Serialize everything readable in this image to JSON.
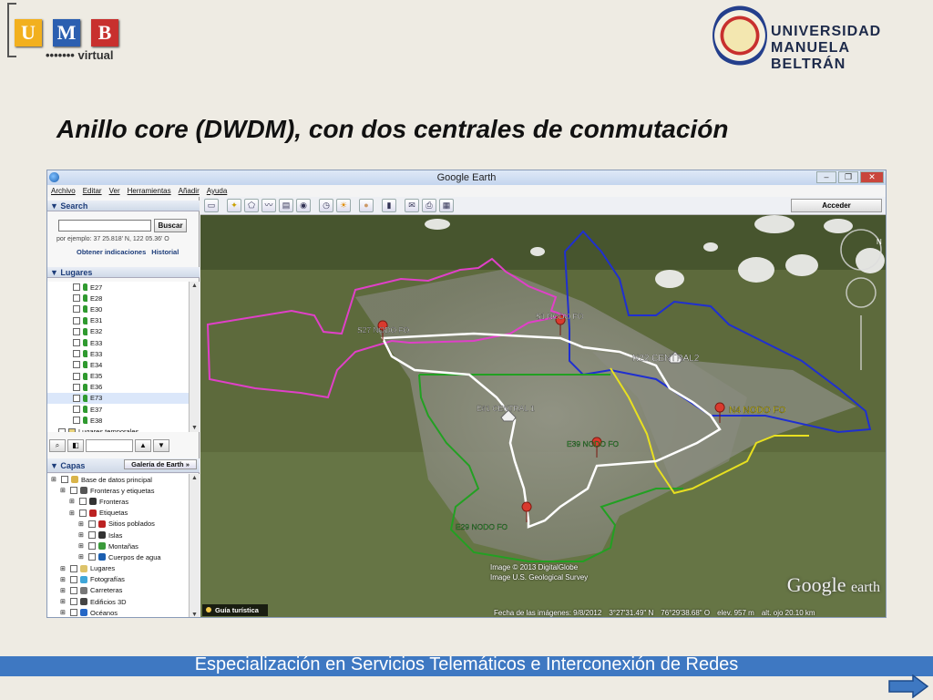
{
  "slide": {
    "title": "Anillo core (DWDM), con dos centrales de conmutación",
    "footer": "Especialización en Servicios Telemáticos e Interconexión de Redes"
  },
  "logos": {
    "umb_letters": [
      "U",
      "M",
      "B"
    ],
    "umb_colors": [
      "#f2b01e",
      "#2b5fb0",
      "#c8302e"
    ],
    "umb_virtual": "virtual",
    "university_line1": "UNIVERSIDAD",
    "university_line2": "MANUELA BELTRÁN"
  },
  "window": {
    "title": "Google Earth",
    "controls": [
      "–",
      "❐",
      "✕"
    ]
  },
  "menu": [
    "Archivo",
    "Editar",
    "Ver",
    "Herramientas",
    "Añadir",
    "Ayuda"
  ],
  "toolbar": {
    "icons": [
      "sidebar-icon",
      "placemark-icon",
      "polygon-icon",
      "path-icon",
      "overlay-icon",
      "tour-icon",
      "historical-imagery-icon",
      "sunlight-icon",
      "planets-icon",
      "ruler-icon",
      "email-icon",
      "print-icon",
      "maps-icon"
    ],
    "acceder_label": "Acceder"
  },
  "search": {
    "header": "▼ Search",
    "button": "Buscar",
    "example": "por ejemplo: 37 25.818' N, 122 05.36' O",
    "link_directions": "Obtener indicaciones",
    "link_history": "Historial"
  },
  "places": {
    "header": "▼ Lugares",
    "items": [
      "E27",
      "E28",
      "E30",
      "E31",
      "E32",
      "E33",
      "E33",
      "E34",
      "E35",
      "E36",
      "E73",
      "E37",
      "E38"
    ],
    "selected": "E73",
    "temporary": "Lugares temporales"
  },
  "layers": {
    "header": "▼ Capas",
    "gallery_button": "Galería de Earth »",
    "items": [
      {
        "label": "Base de datos principal",
        "indent": 0
      },
      {
        "label": "Fronteras y etiquetas",
        "indent": 1
      },
      {
        "label": "Fronteras",
        "indent": 2
      },
      {
        "label": "Etiquetas",
        "indent": 2
      },
      {
        "label": "Sitios poblados",
        "indent": 3
      },
      {
        "label": "Islas",
        "indent": 3
      },
      {
        "label": "Montañas",
        "indent": 3
      },
      {
        "label": "Cuerpos de agua",
        "indent": 3
      },
      {
        "label": "Lugares",
        "indent": 1
      },
      {
        "label": "Fotografías",
        "indent": 1
      },
      {
        "label": "Carreteras",
        "indent": 1
      },
      {
        "label": "Edificios 3D",
        "indent": 1
      },
      {
        "label": "Océanos",
        "indent": 1
      }
    ]
  },
  "map": {
    "nodes": [
      {
        "label": "S27 NODO FO"
      },
      {
        "label": "S1 NODO FO"
      },
      {
        "label": "N22 CENTRAL2"
      },
      {
        "label": "N4 NODO FO"
      },
      {
        "label": "E61 CENTRAL 1"
      },
      {
        "label": "E39 NODO FO"
      },
      {
        "label": "E29 NODO FO"
      }
    ],
    "credits": [
      "Image © 2013 DigitalGlobe",
      "Image U.S. Geological Survey"
    ],
    "guide_label": "Guía turística",
    "status": {
      "date": "Fecha de las imágenes: 9/8/2012",
      "lat": "3°27'31.49\" N",
      "lon": "76°29'38.68\" O",
      "elev": "elev.  957 m",
      "alt": "alt. ojo  20.10 km"
    },
    "logo_google": "Google",
    "logo_earth": "earth",
    "ring_colors": {
      "core": "#ffffff",
      "north": "#1f2fd0",
      "west": "#e040c8",
      "south": "#22a022",
      "east": "#e8e020"
    }
  }
}
